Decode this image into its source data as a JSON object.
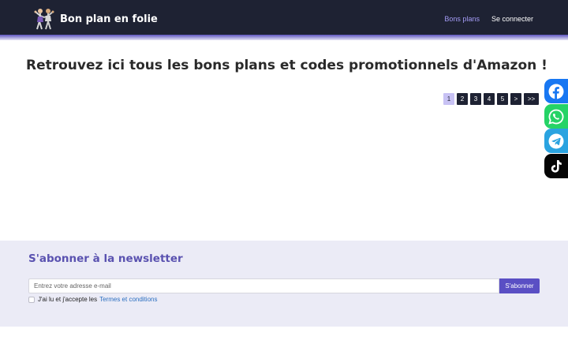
{
  "header": {
    "brand": "Bon plan en folie",
    "nav": [
      {
        "label": "Bons plans",
        "active": true
      },
      {
        "label": "Se connecter",
        "active": false
      }
    ]
  },
  "main": {
    "title": "Retrouvez ici tous les bons plans et codes promotionnels d'Amazon !",
    "pagination": [
      "1",
      "2",
      "3",
      "4",
      "5",
      ">",
      ">>"
    ],
    "current_page": "1"
  },
  "social": [
    {
      "name": "facebook",
      "icon": "facebook-icon",
      "color": "#1877f2"
    },
    {
      "name": "whatsapp",
      "icon": "whatsapp-icon",
      "color": "#25d366"
    },
    {
      "name": "telegram",
      "icon": "telegram-icon",
      "color": "#2aa3e0"
    },
    {
      "name": "tiktok",
      "icon": "tiktok-icon",
      "color": "#050505"
    }
  ],
  "newsletter": {
    "title": "S'abonner à la newsletter",
    "placeholder": "Entrez votre adresse e-mail",
    "button": "S'abonner",
    "consent_text": "J'ai lu et j'accepte les",
    "consent_link": "Termes et conditions"
  },
  "colors": {
    "navbar": "#1e2233",
    "accent": "#5a4fc4",
    "active_link": "#a49cf6"
  }
}
